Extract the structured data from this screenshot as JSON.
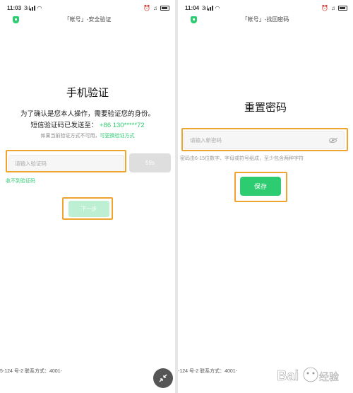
{
  "left": {
    "status": {
      "time": "11:03",
      "net": "3ıl"
    },
    "header_title": "「帐号」-安全验证",
    "title": "手机验证",
    "line1": "为了确认是您本人操作，需要验证您的身份。",
    "line2_prefix": "短信验证码已发送至：",
    "line2_phone": "+86 130*****72",
    "line3_prefix": "如果当前验证方式不可用，",
    "line3_link": "可更换验证方式",
    "code_placeholder": "请输入验证码",
    "send_button": "59s",
    "no_code_link": "收不到验证码",
    "next_button": "下一步",
    "footer": "5-124 号-2 联系方式：4001-"
  },
  "right": {
    "status": {
      "time": "11:04",
      "net": "3ıl"
    },
    "header_title": "「帐号」-找回密码",
    "title": "重置密码",
    "password_placeholder": "请输入新密码",
    "hint": "密码由6-15位数字、字母或符号组成，至少包含两种字符",
    "save_button": "保存",
    "footer": "-124 号-2 联系方式：4001-"
  },
  "watermark_text": "Bai百度经验",
  "colors": {
    "accent": "#2ecc71",
    "highlight": "#f0a430"
  }
}
